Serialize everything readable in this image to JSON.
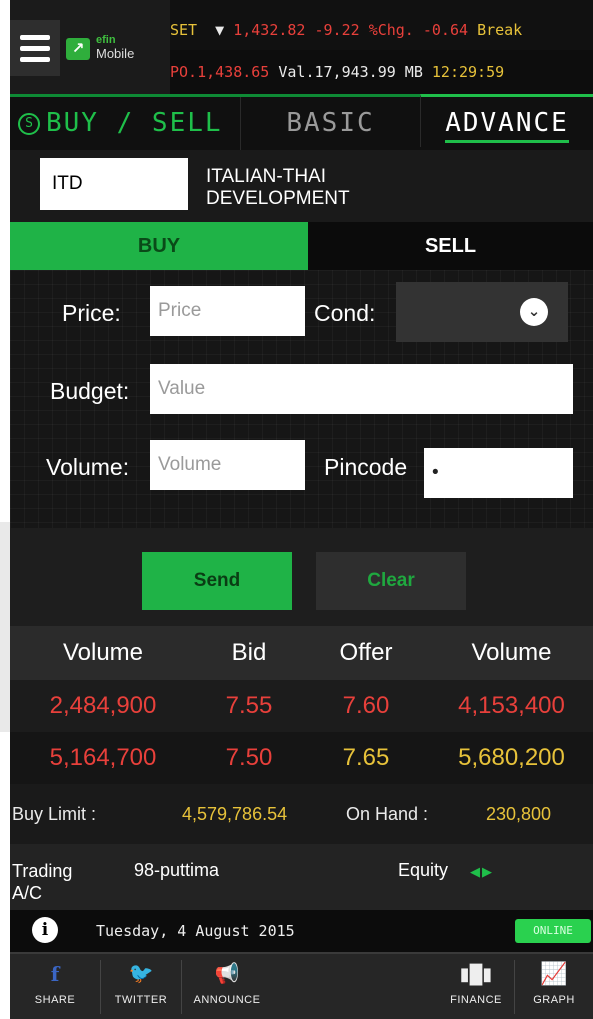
{
  "header": {
    "logo_top": "efin",
    "logo_bottom": "Mobile",
    "index_name": "SET",
    "direction_icon": "down-triangle",
    "index_value": "1,432.82",
    "index_change": "-9.22",
    "pct_change": "%Chg. -0.64",
    "break_label": "Break",
    "po_label": "PO.1,438.65",
    "value_label": "Val.17,943.99 MB",
    "time": "12:29:59"
  },
  "tabs": {
    "buysell": "BUY / SELL",
    "buysell_icon": "S",
    "basic": "BASIC",
    "advance": "ADVANCE"
  },
  "stock": {
    "symbol": "ITD",
    "name": "ITALIAN-THAI DEVELOPMENT"
  },
  "side": {
    "buy": "BUY",
    "sell": "SELL"
  },
  "form": {
    "price_label": "Price:",
    "price_placeholder": "Price",
    "cond_label": "Cond:",
    "budget_label": "Budget:",
    "budget_placeholder": "Value",
    "volume_label": "Volume:",
    "volume_placeholder": "Volume",
    "pincode_label": "Pincode",
    "pincode_value": "•"
  },
  "actions": {
    "send": "Send",
    "clear": "Clear"
  },
  "depth": {
    "headers": [
      "Volume",
      "Bid",
      "Offer",
      "Volume"
    ],
    "rows": [
      [
        "2,484,900",
        "7.55",
        "7.60",
        "4,153,400"
      ],
      [
        "5,164,700",
        "7.50",
        "7.65",
        "5,680,200"
      ]
    ]
  },
  "limits": {
    "buy_limit_label": "Buy Limit :",
    "buy_limit_value": "4,579,786.54",
    "on_hand_label": "On Hand :",
    "on_hand_value": "230,800"
  },
  "trading": {
    "label": "Trading A/C",
    "account": "98-puttima",
    "equity": "Equity"
  },
  "status": {
    "date": "Tuesday, 4 August 2015",
    "online": "ONLINE"
  },
  "bottom_bar": {
    "share": "SHARE",
    "twitter": "TWITTER",
    "announce": "ANNOUNCE",
    "finance": "FINANCE",
    "graph": "GRAPH"
  },
  "colors": {
    "accent": "#1fb347",
    "up": "#e7c23a",
    "down": "#e8403b"
  }
}
